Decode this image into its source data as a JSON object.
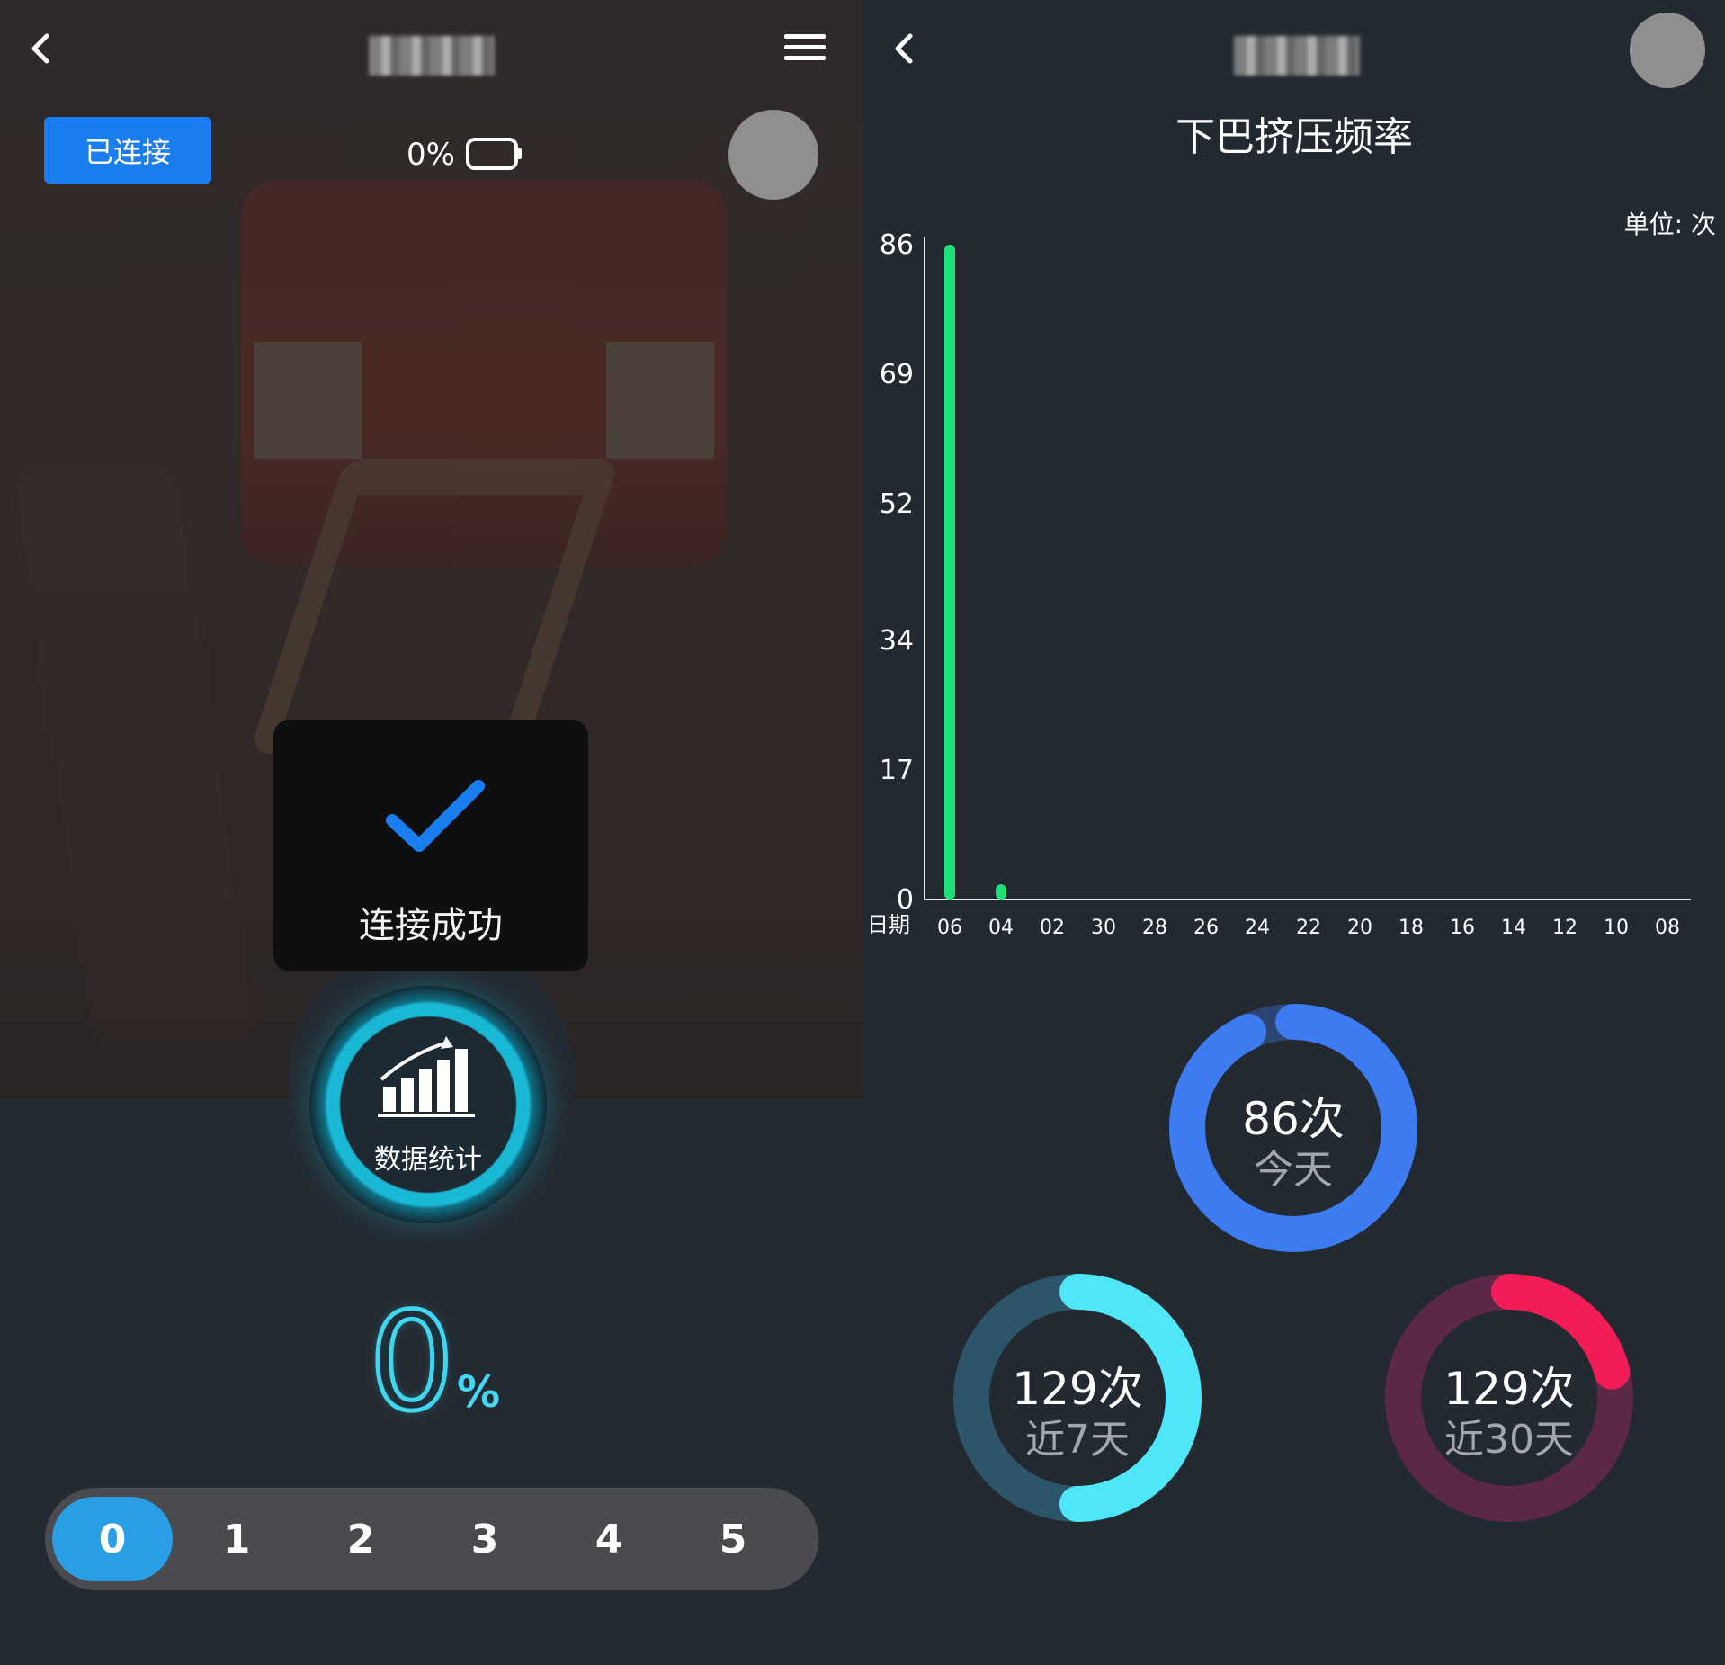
{
  "left": {
    "status_button": "已连接",
    "battery_percent": "0%",
    "battery_level": 0,
    "toast_text": "连接成功",
    "stats_button_label": "数据统计",
    "current_value": "0",
    "current_unit": "%",
    "levels": [
      "0",
      "1",
      "2",
      "3",
      "4",
      "5"
    ],
    "active_level": 0
  },
  "right": {
    "chart_title": "下巴挤压频率",
    "unit_label": "单位: 次",
    "rings": [
      {
        "value": "86次",
        "label": "今天",
        "fraction": 0.93,
        "color": "#3d7bf0",
        "track": "#2c4574"
      },
      {
        "value": "129次",
        "label": "近7天",
        "fraction": 0.5,
        "color": "#4fe6f7",
        "track": "#2d5569"
      },
      {
        "value": "129次",
        "label": "近30天",
        "fraction": 0.21,
        "color": "#f21c57",
        "track": "#5b2847"
      }
    ]
  },
  "chart_data": {
    "type": "bar",
    "title": "下巴挤压频率",
    "xlabel": "日期",
    "ylabel": "",
    "unit": "单位: 次",
    "categories": [
      "06",
      "04",
      "02",
      "30",
      "28",
      "26",
      "24",
      "22",
      "20",
      "18",
      "16",
      "14",
      "12",
      "10",
      "08"
    ],
    "values": [
      86,
      2,
      0,
      0,
      0,
      0,
      0,
      0,
      0,
      0,
      0,
      0,
      0,
      0,
      0
    ],
    "yticks": [
      0,
      17,
      34,
      52,
      69,
      86
    ],
    "ylim": [
      0,
      86
    ],
    "bar_color": "#1de27a",
    "grid": false
  }
}
